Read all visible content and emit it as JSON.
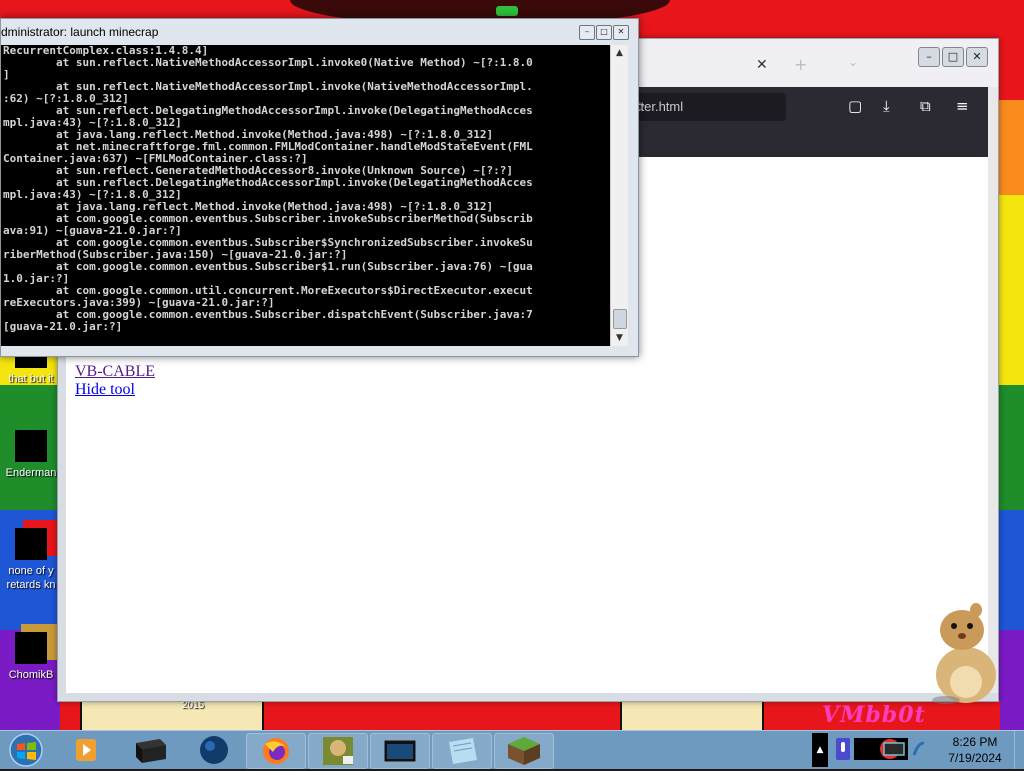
{
  "console": {
    "title": "dministrator:  launch minecrap",
    "lines": [
      "RecurrentComplex.class:1.4.8.4]",
      "        at sun.reflect.NativeMethodAccessorImpl.invoke0(Native Method) ~[?:1.8.0",
      "]",
      "        at sun.reflect.NativeMethodAccessorImpl.invoke(NativeMethodAccessorImpl.",
      ":62) ~[?:1.8.0_312]",
      "        at sun.reflect.DelegatingMethodAccessorImpl.invoke(DelegatingMethodAcces",
      "mpl.java:43) ~[?:1.8.0_312]",
      "        at java.lang.reflect.Method.invoke(Method.java:498) ~[?:1.8.0_312]",
      "        at net.minecraftforge.fml.common.FMLModContainer.handleModStateEvent(FML",
      "Container.java:637) ~[FMLModContainer.class:?]",
      "        at sun.reflect.GeneratedMethodAccessor8.invoke(Unknown Source) ~[?:?]",
      "        at sun.reflect.DelegatingMethodAccessorImpl.invoke(DelegatingMethodAcces",
      "mpl.java:43) ~[?:1.8.0_312]",
      "        at java.lang.reflect.Method.invoke(Method.java:498) ~[?:1.8.0_312]",
      "        at com.google.common.eventbus.Subscriber.invokeSubscriberMethod(Subscrib",
      "ava:91) ~[guava-21.0.jar:?]",
      "        at com.google.common.eventbus.Subscriber$SynchronizedSubscriber.invokeSu",
      "riberMethod(Subscriber.java:150) ~[guava-21.0.jar:?]",
      "        at com.google.common.eventbus.Subscriber$1.run(Subscriber.java:76) ~[gua",
      "1.0.jar:?]",
      "        at com.google.common.util.concurrent.MoreExecutors$DirectExecutor.execut",
      "reExecutors.java:399) ~[guava-21.0.jar:?]",
      "        at com.google.common.eventbus.Subscriber.dispatchEvent(Subscriber.java:7",
      "[guava-21.0.jar:?]"
    ],
    "buttons": {
      "minimize": "–",
      "maximize": "□",
      "close": "✕"
    },
    "scroll": {
      "up": "▲",
      "down": "▼"
    }
  },
  "browser": {
    "url_fragment": "itter.html",
    "tab_close": "✕",
    "tab_new": "+",
    "tab_list": "⌄",
    "buttons": {
      "minimize": "–",
      "maximize": "□",
      "close": "✕"
    },
    "toolbar_icons": {
      "bookmark": "☆",
      "pocket": "▢",
      "downloads": "⤓",
      "extensions": "⧉",
      "menu": "≡"
    },
    "links": [
      {
        "text": "VB-CABLE",
        "color": "#551a8b"
      },
      {
        "text": "Hide tool",
        "color": "#0000ee"
      }
    ]
  },
  "desktop": {
    "icons": [
      {
        "label": "that but it"
      },
      {
        "label": "Enderman"
      },
      {
        "label": "none of y retards kn"
      },
      {
        "label": "ChomikB"
      }
    ],
    "bottom_text": "VMbb0t",
    "small_text": "2015"
  },
  "taskbar": {
    "items": [
      "media-player",
      "terminal-box",
      "globe",
      "firefox",
      "box-game",
      "console",
      "notepad",
      "minecraft"
    ],
    "tray_arrow": "▲",
    "time": "8:26 PM",
    "date": "7/19/2024"
  }
}
